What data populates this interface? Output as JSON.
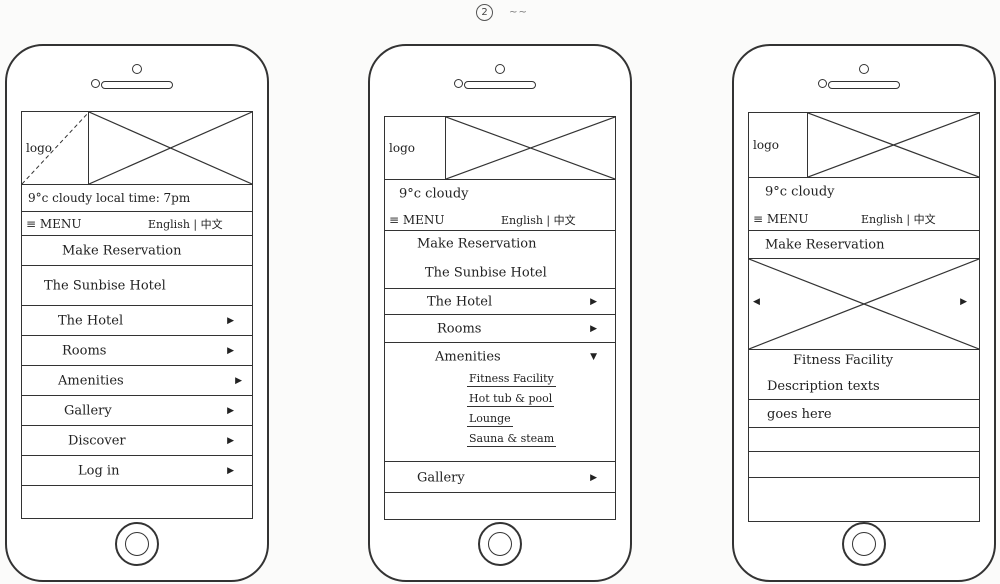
{
  "page_number": "2",
  "page_marks": "~~",
  "phone1": {
    "logo": "logo",
    "weather": "9°c cloudy local time: 7pm",
    "menu": "≡ MENU",
    "lang": "English | 中文",
    "reservation": "Make Reservation",
    "hotel_name": "The Sunbise Hotel",
    "nav": [
      {
        "label": "The Hotel",
        "icon": "triangle-arrow"
      },
      {
        "label": "Rooms",
        "icon": "triangle-arrow"
      },
      {
        "label": "Amenities",
        "icon": "triangle-arrow"
      },
      {
        "label": "Gallery",
        "icon": "triangle-arrow"
      },
      {
        "label": "Discover",
        "icon": "triangle-arrow"
      },
      {
        "label": "Log in",
        "icon": "triangle-arrow"
      }
    ]
  },
  "phone2": {
    "logo": "logo",
    "weather": "9°c cloudy",
    "menu": "≡ MENU",
    "lang": "English | 中文",
    "reservation": "Make Reservation",
    "hotel_name": "The Sunbise Hotel",
    "nav": [
      {
        "label": "The Hotel"
      },
      {
        "label": "Rooms"
      },
      {
        "label": "Amenities"
      }
    ],
    "sub_items": [
      "Fitness Facility",
      "Hot tub & pool",
      "Lounge",
      "Sauna & steam"
    ],
    "gallery": "Gallery"
  },
  "phone3": {
    "logo": "logo",
    "weather": "9°c cloudy",
    "menu": "≡ MENU",
    "lang": "English | 中文",
    "reservation": "Make Reservation",
    "detail_title": "Fitness Facility",
    "detail_text_1": "Description texts",
    "detail_text_2": "goes here"
  },
  "colors": {
    "ink": "#222222",
    "paper": "#fbfbfa"
  }
}
